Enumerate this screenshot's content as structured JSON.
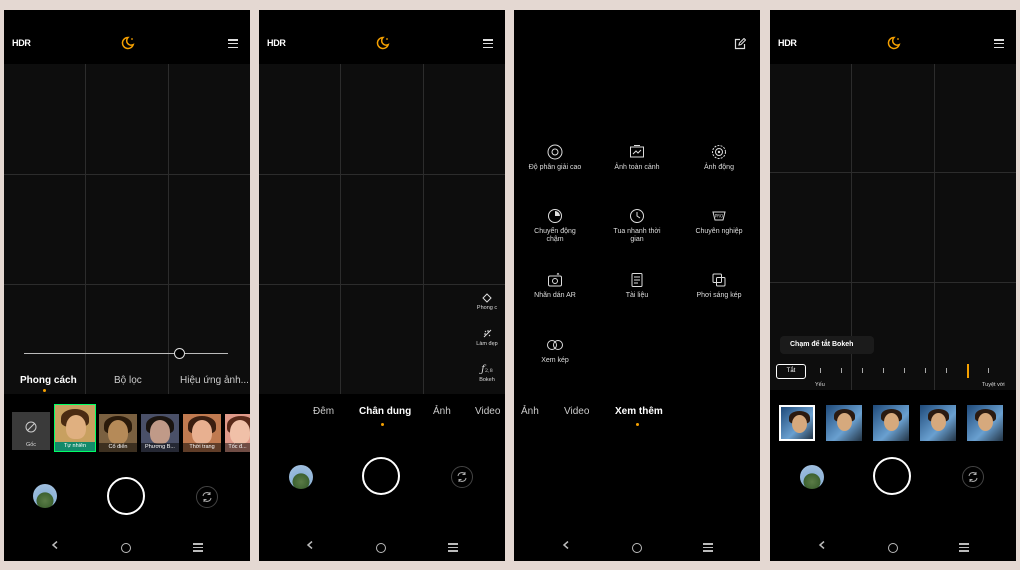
{
  "colors": {
    "accent": "#f5a000",
    "background": "#000000",
    "page": "#e4d8d2"
  },
  "screen1": {
    "hdr": "HDR",
    "tabs": [
      "Phong cách",
      "Bộ lọc",
      "Hiệu ứng ảnh..."
    ],
    "active_tab": 0,
    "slider_value_percent": 76,
    "styles": [
      "Gốc",
      "Tự nhiên",
      "Cổ điển",
      "Phương B...",
      "Thời trang",
      "Tốc đ..."
    ],
    "selected_style": 1
  },
  "screen2": {
    "hdr": "HDR",
    "side_tools": [
      {
        "label": "Phong c",
        "icon": "diamond-icon"
      },
      {
        "label": "Làm đẹp",
        "icon": "beauty-icon"
      },
      {
        "label": "Bokeh",
        "icon": "aperture-f-icon",
        "value": "2,8"
      }
    ],
    "modes": [
      "Đêm",
      "Chân dung",
      "Ảnh",
      "Video"
    ],
    "active_mode": 1
  },
  "screen3": {
    "modes_grid": [
      {
        "label": "Độ phân giải cao",
        "icon": "high-resolution-icon"
      },
      {
        "label": "Ảnh toàn cảnh",
        "icon": "panorama-icon"
      },
      {
        "label": "Ảnh động",
        "icon": "live-photo-icon"
      },
      {
        "label": "Chuyển động chậm",
        "icon": "slow-motion-icon"
      },
      {
        "label": "Tua nhanh thời gian",
        "icon": "timelapse-icon"
      },
      {
        "label": "Chuyên nghiệp",
        "icon": "pro-icon"
      },
      {
        "label": "Nhãn dán AR",
        "icon": "ar-sticker-icon"
      },
      {
        "label": "Tài liệu",
        "icon": "document-icon"
      },
      {
        "label": "Phơi sáng kép",
        "icon": "double-exposure-icon"
      },
      {
        "label": "Xem kép",
        "icon": "dual-view-icon"
      }
    ],
    "modes": [
      "Ảnh",
      "Video",
      "Xem thêm"
    ],
    "active_mode": 2
  },
  "screen4": {
    "hdr": "HDR",
    "tooltip": "Chạm để tắt Bokeh",
    "off_button": "Tắt",
    "scale_min": "Yếu",
    "scale_max": "Tuyệt vời",
    "bokeh_level_index": 7,
    "bokeh_levels": 9,
    "thumbnails": 5,
    "selected_thumbnail": 0
  }
}
